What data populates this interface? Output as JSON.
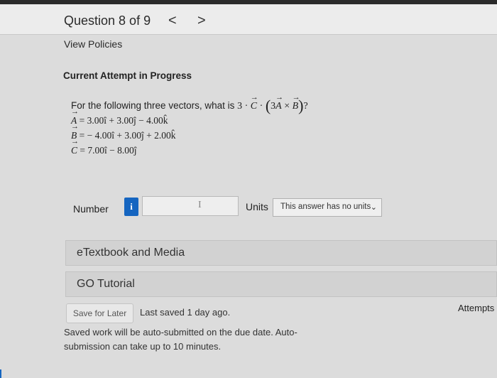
{
  "header": {
    "question_label": "Question 8 of 9",
    "prev_glyph": "<",
    "next_glyph": ">"
  },
  "links": {
    "view_policies": "View Policies"
  },
  "attempt": {
    "title": "Current Attempt in Progress"
  },
  "question": {
    "prompt_prefix": "For the following three vectors, what is",
    "prompt_expression": {
      "coef": "3",
      "dot": "·",
      "vec_c": "C",
      "dot2": "·",
      "inner_coef": "3",
      "vec_a": "A",
      "cross": "×",
      "vec_b": "B",
      "qmark": "?"
    },
    "equations": [
      {
        "vector": "A",
        "rhs": "= 3.00î + 3.00ĵ − 4.00k̂"
      },
      {
        "vector": "B",
        "rhs": "= − 4.00î + 3.00ĵ + 2.00k̂"
      },
      {
        "vector": "C",
        "rhs": "= 7.00î − 8.00ĵ"
      }
    ]
  },
  "answer": {
    "number_label": "Number",
    "info_glyph": "i",
    "number_value": "",
    "cursor_glyph": "I",
    "units_label": "Units",
    "units_selected": "This answer has no units",
    "units_chevron": "⌄"
  },
  "resources": {
    "etextbook_label": "eTextbook and Media",
    "tutorial_label": "GO Tutorial"
  },
  "save": {
    "button_label": "Save for Later",
    "last_saved": "Last saved 1 day ago.",
    "attempts_label": "Attempts",
    "note": "Saved work will be auto-submitted on the due date. Auto-submission can take up to 10 minutes."
  },
  "colors": {
    "info_blue": "#1565c0",
    "page_bg": "#dcdcdc"
  }
}
